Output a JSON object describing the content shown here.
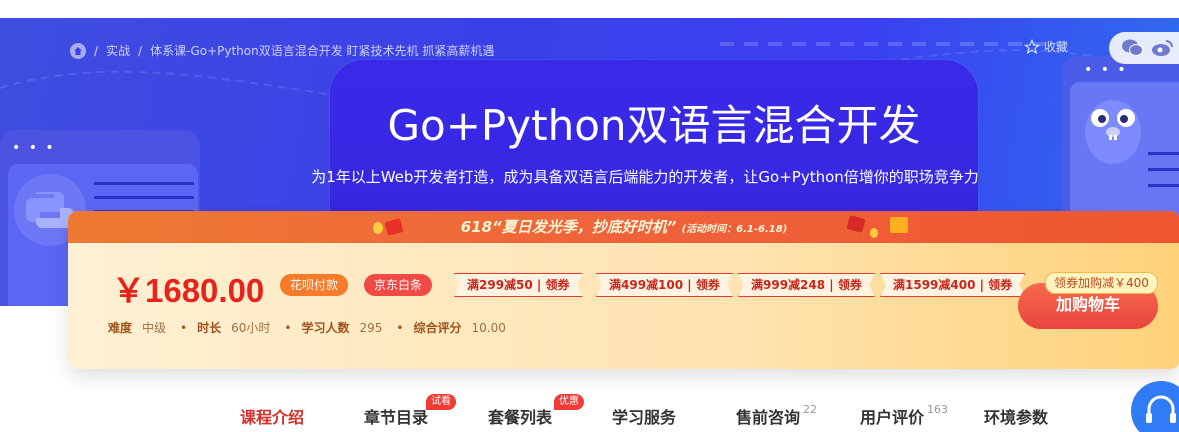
{
  "breadcrumb": {
    "items": [
      "实战",
      "体系课-Go+Python双语言混合开发 盯紧技术先机 抓紧高薪机遇"
    ]
  },
  "actions": {
    "collect_label": "收藏"
  },
  "hero": {
    "title": "Go+Python双语言混合开发",
    "subtitle": "为1年以上Web开发者打造，成为具备双语言后端能力的开发者，让Go+Python倍增你的职场竞争力"
  },
  "promo": {
    "slogan": "618“夏日发光季，抄底好时机”",
    "period": "(活动时间：6.1-6.18)",
    "price": "￥1680.00",
    "tags": [
      "花呗付款",
      "京东白条"
    ],
    "coupons": [
      "满299减50 | 领券",
      "满499减100 | 领券",
      "满999减248 | 领券",
      "满1599减400 | 领券"
    ],
    "meta": [
      {
        "key": "难度",
        "value": "中级"
      },
      {
        "key": "时长",
        "value": "60小时"
      },
      {
        "key": "学习人数",
        "value": "295"
      },
      {
        "key": "综合评分",
        "value": "10.00"
      }
    ],
    "discount_tip": "领券加购减￥400",
    "cart_label": "加购物车"
  },
  "tabs": [
    {
      "label": "课程介绍",
      "badge": "",
      "count": ""
    },
    {
      "label": "章节目录",
      "badge": "试看",
      "count": ""
    },
    {
      "label": "套餐列表",
      "badge": "优惠",
      "count": ""
    },
    {
      "label": "学习服务",
      "badge": "",
      "count": ""
    },
    {
      "label": "售前咨询",
      "badge": "",
      "count": "22"
    },
    {
      "label": "用户评价",
      "badge": "",
      "count": "163"
    },
    {
      "label": "环境参数",
      "badge": "",
      "count": ""
    }
  ],
  "colors": {
    "accent": "#d7302a",
    "banner": "#3b3ff0",
    "cart": "#e94440"
  },
  "icons": [
    "home-icon",
    "star-icon",
    "wechat-icon",
    "weibo-icon",
    "python-logo-icon",
    "gopher-icon",
    "gift-icon",
    "support-headset-icon"
  ]
}
